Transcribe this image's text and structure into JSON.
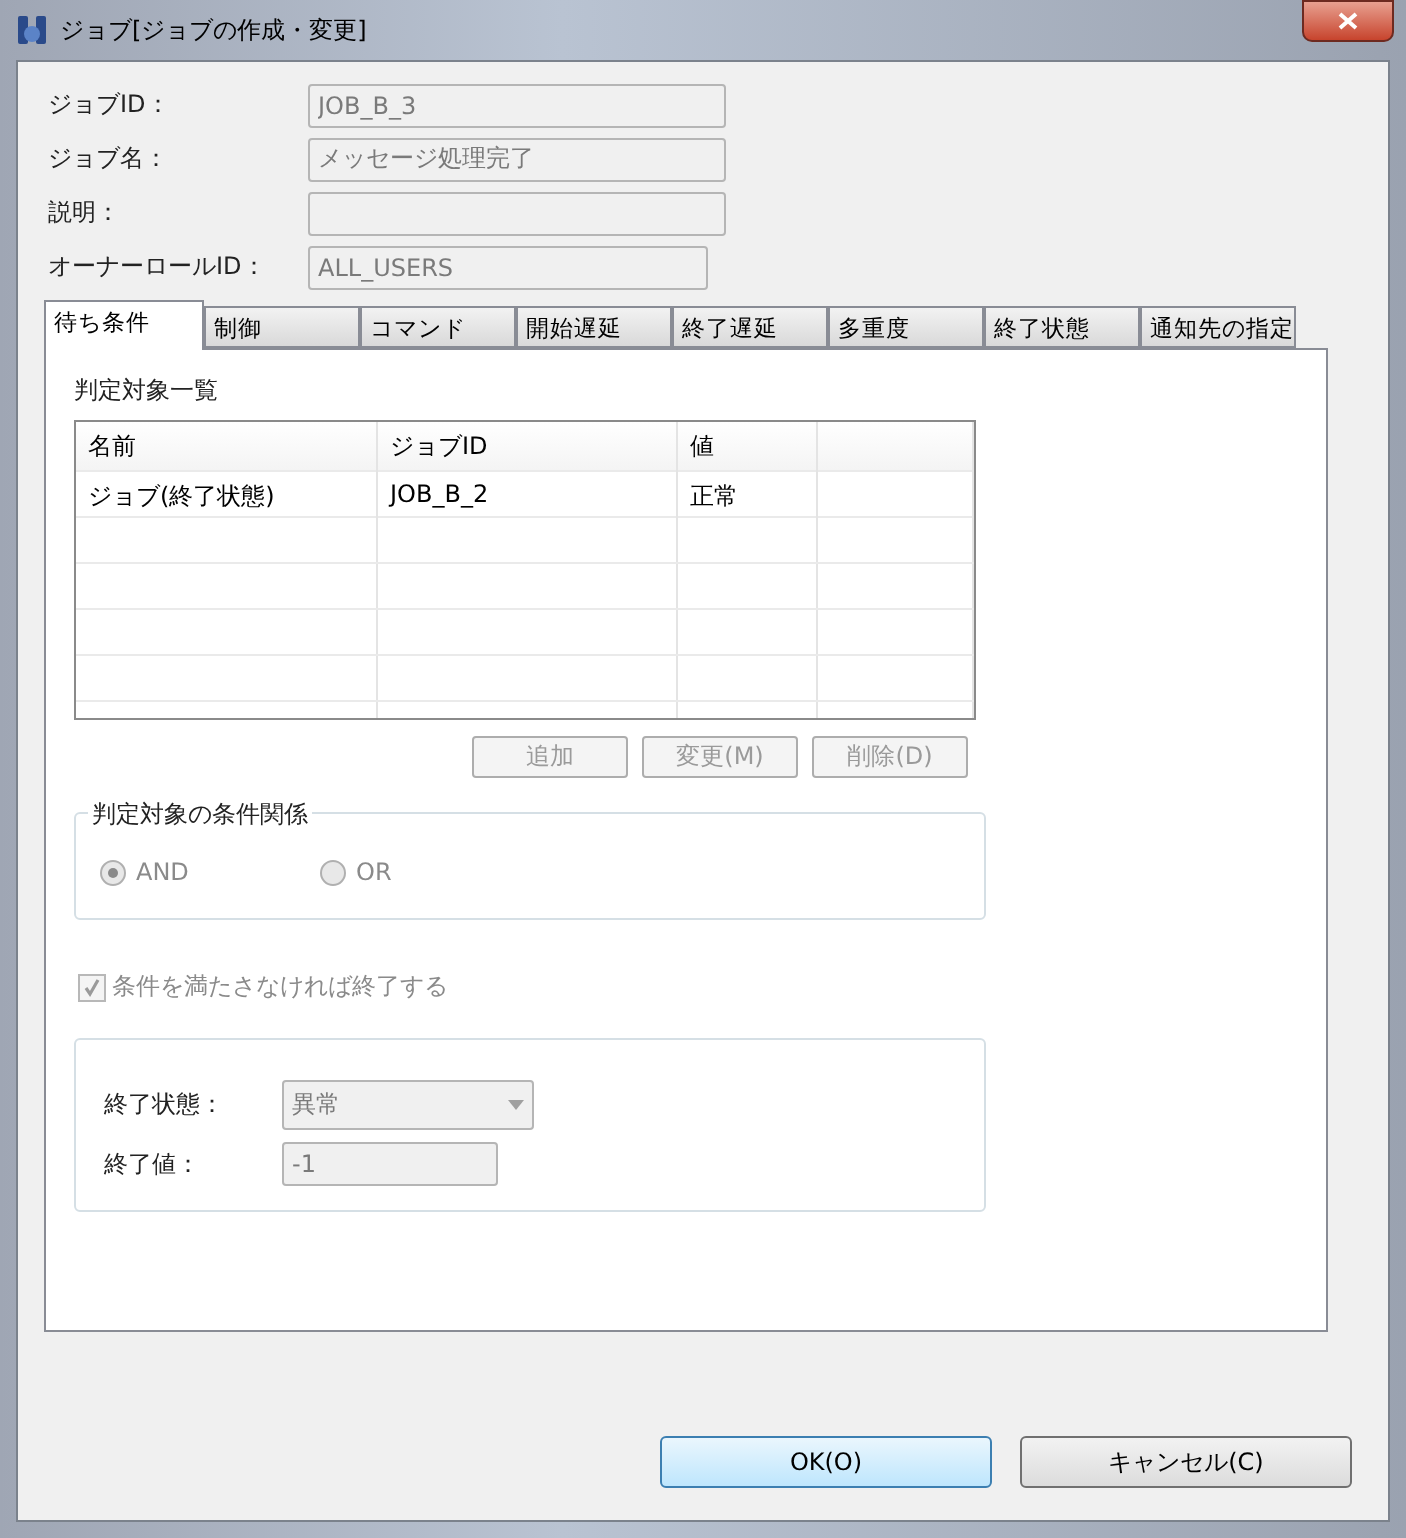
{
  "window": {
    "title": "ジョブ[ジョブの作成・変更]"
  },
  "fields": [
    {
      "label": "ジョブID：",
      "value": "JOB_B_3",
      "disabled": true
    },
    {
      "label": "ジョブ名：",
      "value": "メッセージ処理完了",
      "disabled": true
    },
    {
      "label": "説明：",
      "disabled": true
    },
    {
      "label": "オーナーロールID：",
      "value": "ALL_USERS",
      "disabled": true
    }
  ],
  "tabs": [
    {
      "label": "待ち条件",
      "selected": true
    },
    {
      "label": "制御",
      "selected": false
    },
    {
      "label": "コマンド",
      "selected": false
    },
    {
      "label": "開始遅延",
      "selected": false
    },
    {
      "label": "終了遅延",
      "selected": false
    },
    {
      "label": "多重度",
      "selected": false
    },
    {
      "label": "終了状態",
      "selected": false
    },
    {
      "label": "通知先の指定",
      "selected": false
    }
  ],
  "table": {
    "title": "判定対象一覧",
    "columns": [
      "名前",
      "ジョブID",
      "値"
    ],
    "rows": [
      [
        "ジョブ(終了状態)",
        "JOB_B_2",
        "正常"
      ]
    ]
  },
  "table_buttons": [
    {
      "label": "追加",
      "disabled": true
    },
    {
      "label": "変更(M)",
      "disabled": true
    },
    {
      "label": "削除(D)",
      "disabled": true
    }
  ],
  "condition_group": {
    "title": "判定対象の条件関係",
    "options": [
      {
        "label": "AND",
        "selected": true,
        "disabled": true
      },
      {
        "label": "OR",
        "selected": false,
        "disabled": true
      }
    ]
  },
  "end_if_unmet": {
    "label": "条件を満たさなければ終了する",
    "checked": true,
    "disabled": true
  },
  "end_group": {
    "status_label": "終了状態：",
    "status_value": "異常",
    "value_label": "終了値：",
    "value": "-1"
  },
  "buttons": [
    {
      "label": "OK(O)",
      "kind": "default"
    },
    {
      "label": "キャンセル(C)",
      "kind": "normal"
    }
  ]
}
